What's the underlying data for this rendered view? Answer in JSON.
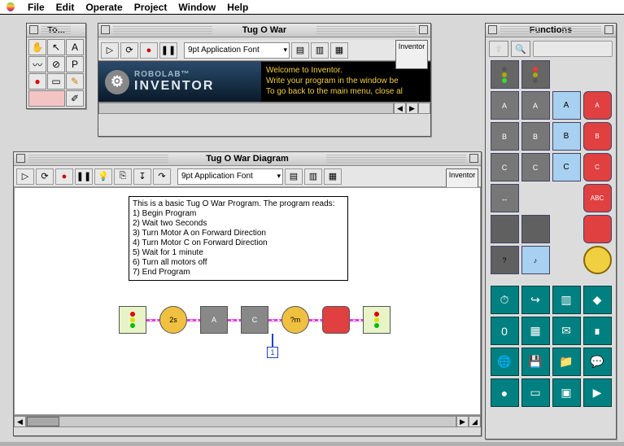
{
  "menu": {
    "items": [
      "File",
      "Edit",
      "Operate",
      "Project",
      "Window",
      "Help"
    ]
  },
  "tools_palette": {
    "title": "To..."
  },
  "inventor_window": {
    "title": "Tug O War",
    "font": "9pt Application Font",
    "mode_tab": "Inventor",
    "brand1": "ROBOLAB™",
    "brand2": "INVENTOR",
    "welcome_lines": [
      "Welcome to Inventor.",
      "Write your program in the window be",
      "To go back to the main menu, close al"
    ]
  },
  "diagram_window": {
    "title": "Tug O War Diagram",
    "font": "9pt Application Font",
    "mode_tab": "Inventor",
    "comment_lines": [
      "This is a basic Tug O War Program. The program reads:",
      "1) Begin Program",
      "2) Wait two Seconds",
      "3) Turn Motor A on Forward Direction",
      "4) Turn Motor C on Forward Direction",
      "5) Wait for 1 minute",
      "6) Turn all motors off",
      "7) End Program"
    ],
    "nodes": [
      {
        "name": "begin-node",
        "label": "",
        "cls": "light"
      },
      {
        "name": "wait-2s-node",
        "label": "2s",
        "cls": "wait"
      },
      {
        "name": "motor-a-node",
        "label": "A",
        "cls": "motor"
      },
      {
        "name": "motor-c-node",
        "label": "C",
        "cls": "motor"
      },
      {
        "name": "wait-1m-node",
        "label": "?m",
        "cls": "wait"
      },
      {
        "name": "stop-all-node",
        "label": "",
        "cls": "stop"
      },
      {
        "name": "end-node",
        "label": "",
        "cls": "light"
      }
    ],
    "selector_value": "1"
  },
  "functions_palette": {
    "title": "Functions",
    "section1": [
      {
        "name": "traffic-green-icon",
        "label": "",
        "type": "traffic-g"
      },
      {
        "name": "traffic-red-icon",
        "label": "",
        "type": "traffic-r"
      },
      {
        "name": "empty",
        "type": "empty"
      },
      {
        "name": "empty",
        "type": "empty"
      },
      {
        "name": "motor-a-fwd-icon",
        "label": "A",
        "type": "motor"
      },
      {
        "name": "motor-a-rev-icon",
        "label": "A",
        "type": "motor"
      },
      {
        "name": "motor-a-flip-icon",
        "label": "A",
        "type": "flip"
      },
      {
        "name": "stop-a-icon",
        "label": "A",
        "type": "stop"
      },
      {
        "name": "motor-b-fwd-icon",
        "label": "B",
        "type": "motor"
      },
      {
        "name": "motor-b-rev-icon",
        "label": "B",
        "type": "motor"
      },
      {
        "name": "motor-b-flip-icon",
        "label": "B",
        "type": "flip"
      },
      {
        "name": "stop-b-icon",
        "label": "B",
        "type": "stop"
      },
      {
        "name": "motor-c-fwd-icon",
        "label": "C",
        "type": "motor"
      },
      {
        "name": "motor-c-rev-icon",
        "label": "C",
        "type": "motor"
      },
      {
        "name": "motor-c-flip-icon",
        "label": "C",
        "type": "flip"
      },
      {
        "name": "stop-c-icon",
        "label": "C",
        "type": "stop"
      },
      {
        "name": "motor-all-fwd-icon",
        "label": "↔",
        "type": "motor"
      },
      {
        "name": "empty",
        "type": "empty"
      },
      {
        "name": "empty",
        "type": "empty"
      },
      {
        "name": "stop-abc-icon",
        "label": "ABC",
        "type": "stop"
      },
      {
        "name": "sub1-icon",
        "label": "",
        "type": "dark"
      },
      {
        "name": "sub2-icon",
        "label": "",
        "type": "dark"
      },
      {
        "name": "empty",
        "type": "empty"
      },
      {
        "name": "stop-generic-icon",
        "label": "",
        "type": "stop"
      },
      {
        "name": "task-icon",
        "label": "?",
        "type": "dark"
      },
      {
        "name": "sound-icon",
        "label": "♪",
        "type": "plain"
      },
      {
        "name": "empty",
        "type": "empty"
      },
      {
        "name": "lamp-icon",
        "label": "",
        "type": "yellow"
      }
    ],
    "section2": [
      {
        "name": "wait-time-icon",
        "label": "⏱"
      },
      {
        "name": "jump-icon",
        "label": "↪"
      },
      {
        "name": "piano-icon",
        "label": "▥"
      },
      {
        "name": "diamond-icon",
        "label": "◆"
      },
      {
        "name": "zero-icon",
        "label": "0"
      },
      {
        "name": "container-icon",
        "label": "▦"
      },
      {
        "name": "mail-icon",
        "label": "✉"
      },
      {
        "name": "candle-icon",
        "label": "∎"
      },
      {
        "name": "globe-icon",
        "label": "🌐"
      },
      {
        "name": "disk-icon",
        "label": "💾"
      },
      {
        "name": "folder-icon",
        "label": "📁"
      },
      {
        "name": "speech-icon",
        "label": "💬"
      },
      {
        "name": "light2-icon",
        "label": "●"
      },
      {
        "name": "brick-icon",
        "label": "▭"
      },
      {
        "name": "chip-icon",
        "label": "▣"
      },
      {
        "name": "camera-icon",
        "label": "▶"
      }
    ]
  }
}
